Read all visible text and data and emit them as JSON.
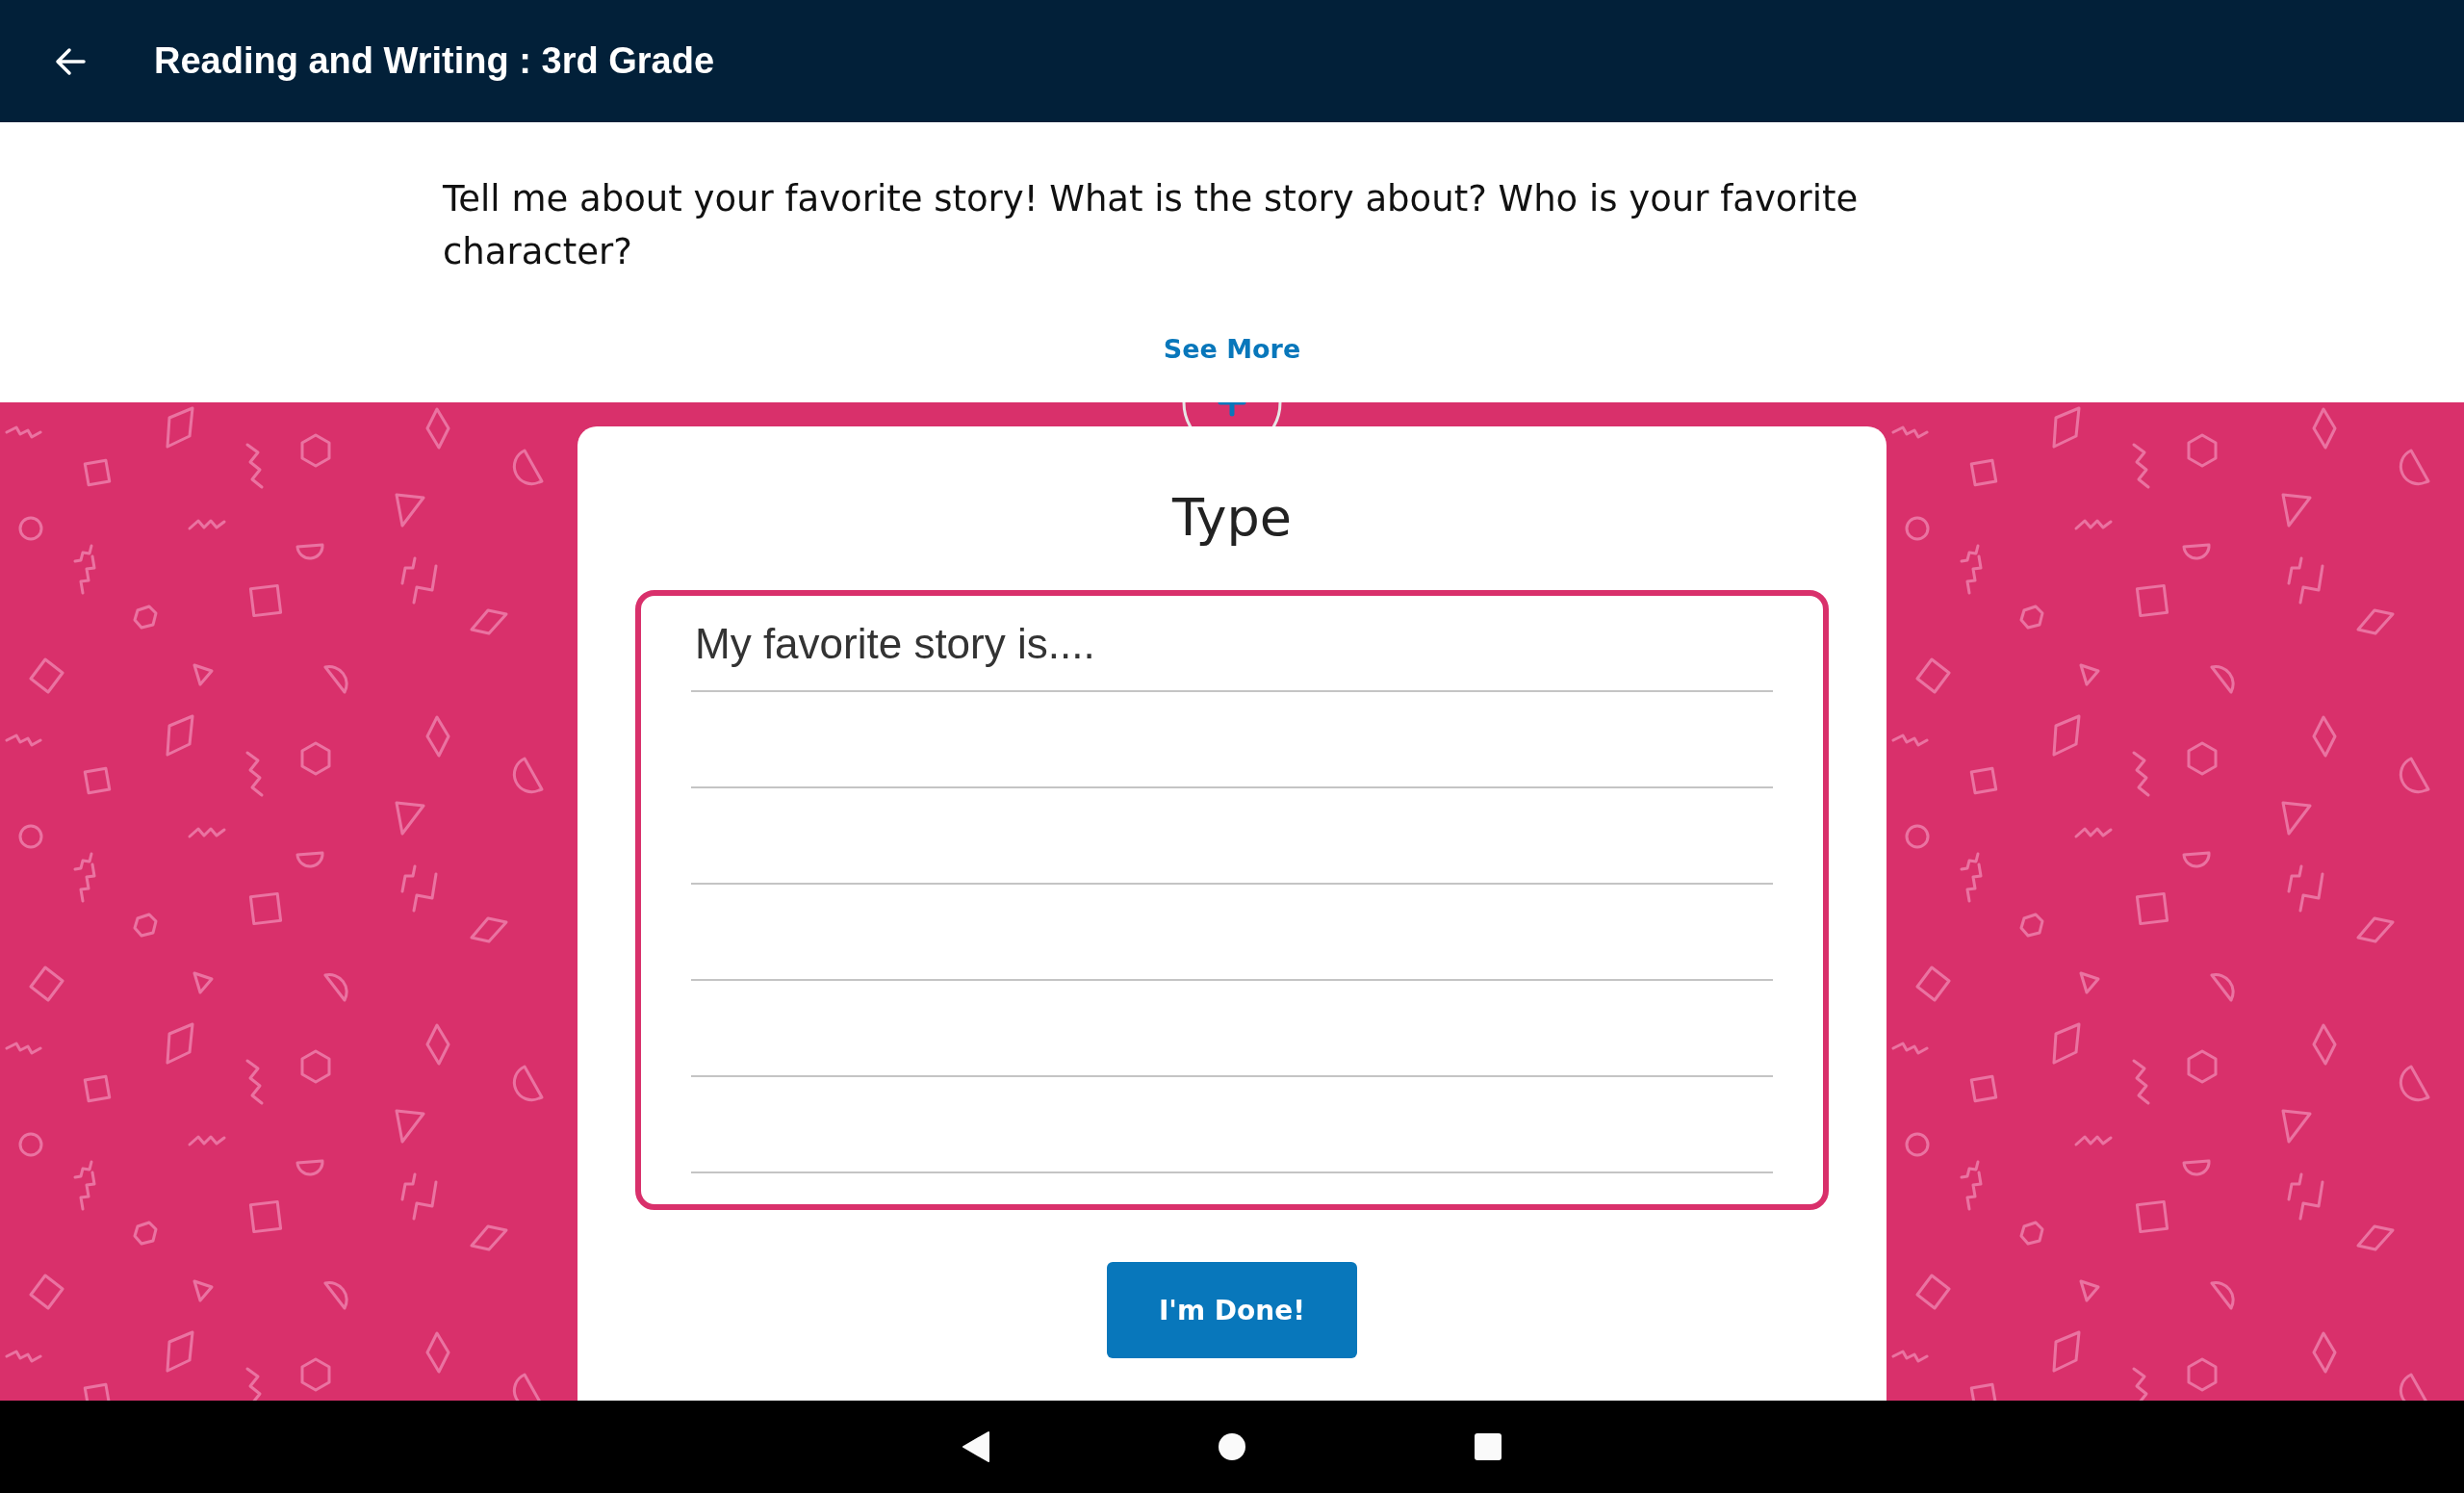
{
  "app_bar": {
    "title": "Reading and Writing : 3rd Grade"
  },
  "prompt": {
    "text": "Tell me about your favorite story! What is the story about? Who is your favorite character?",
    "see_more": "See More"
  },
  "response_card": {
    "title": "Type",
    "answer": {
      "placeholder": "My favorite story is...."
    },
    "done_button": "I'm Done!"
  }
}
